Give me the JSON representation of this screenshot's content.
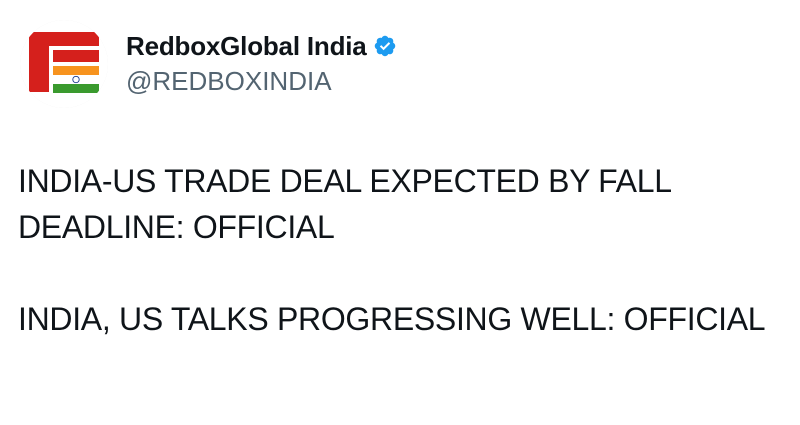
{
  "account": {
    "display_name": "RedboxGlobal India",
    "handle": "@REDBOXINDIA",
    "avatar_icon": "redbox-india-logo",
    "verified_icon": "verified-badge-icon",
    "colors": {
      "brand_red": "#d5201c",
      "saffron": "#f7931e",
      "green": "#3a9a2e",
      "verified_blue": "#1d9bf0"
    }
  },
  "tweet": {
    "paragraphs": [
      "INDIA-US TRADE DEAL EXPECTED BY FALL DEADLINE: OFFICIAL",
      "INDIA, US TALKS PROGRESSING WELL: OFFICIAL"
    ]
  }
}
